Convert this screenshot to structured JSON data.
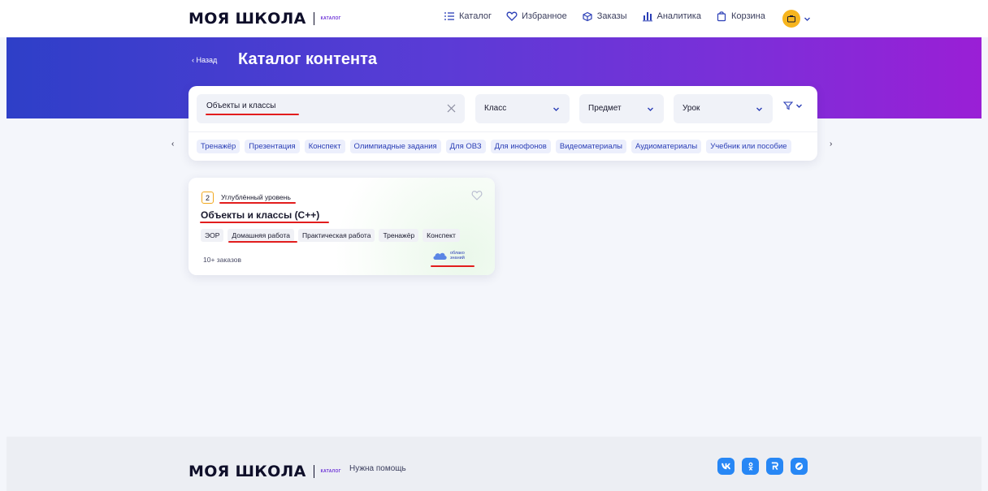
{
  "header": {
    "logo_text": "МОЯ ШКОЛА",
    "logo_badge": "каталог",
    "nav": [
      {
        "label": "Каталог",
        "icon": "list-icon"
      },
      {
        "label": "Избранное",
        "icon": "heart-icon"
      },
      {
        "label": "Заказы",
        "icon": "box-icon"
      },
      {
        "label": "Аналитика",
        "icon": "chart-icon"
      },
      {
        "label": "Корзина",
        "icon": "bag-icon"
      }
    ],
    "profile_icon": "briefcase-icon"
  },
  "hero": {
    "back_label": "‹ Назад",
    "title": "Каталог контента"
  },
  "search": {
    "value": "Объекты и классы",
    "filters": [
      {
        "label": "Класс"
      },
      {
        "label": "Предмет"
      },
      {
        "label": "Урок"
      }
    ]
  },
  "tags": [
    "Тренажёр",
    "Презентация",
    "Конспект",
    "Олимпиадные задания",
    "Для ОВЗ",
    "Для инофонов",
    "Видеоматериалы",
    "Аудиоматериалы",
    "Учебник или пособие"
  ],
  "card": {
    "grade": "2",
    "level": "Углублённый уровень",
    "title": "Объекты и классы (С++)",
    "chips": [
      "ЭОР",
      "Домашняя работа",
      "Практическая работа",
      "Тренажёр",
      "Конспект"
    ],
    "orders": "10+ заказов",
    "provider_line1": "облако",
    "provider_line2": "знаний"
  },
  "footer": {
    "logo_text": "МОЯ ШКОЛА",
    "logo_badge": "каталог",
    "help": "Нужна помощь",
    "socials": [
      "vk-icon",
      "ok-icon",
      "rutube-icon",
      "sferum-icon"
    ]
  },
  "colors": {
    "accent": "#2a3eb6",
    "highlight": "#e21d1d",
    "hero_start": "#2e3fc8",
    "hero_end": "#9a1fd6",
    "avatar": "#f7b51e"
  }
}
